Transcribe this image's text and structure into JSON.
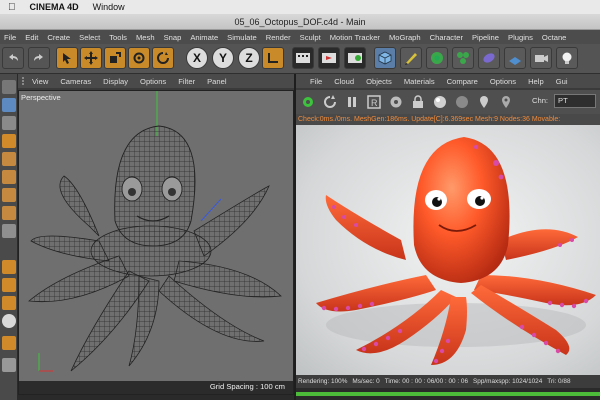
{
  "macos": {
    "app": "CINEMA 4D",
    "menu": [
      "Window"
    ]
  },
  "window": {
    "title": "05_06_Octopus_DOF.c4d - Main"
  },
  "main_menu": [
    "File",
    "Edit",
    "Create",
    "Select",
    "Tools",
    "Mesh",
    "Snap",
    "Animate",
    "Simulate",
    "Render",
    "Sculpt",
    "Motion Tracker",
    "MoGraph",
    "Character",
    "Pipeline",
    "Plugins",
    "Octane"
  ],
  "toolbar": {
    "axis_x": "X",
    "axis_y": "Y",
    "axis_z": "Z"
  },
  "viewport": {
    "menu": [
      "View",
      "Cameras",
      "Display",
      "Options",
      "Filter",
      "Panel"
    ],
    "label": "Perspective",
    "grid_spacing": "Grid Spacing : 100 cm"
  },
  "render_view": {
    "menu": [
      "File",
      "Cloud",
      "Objects",
      "Materials",
      "Compare",
      "Options",
      "Help",
      "Gui"
    ],
    "channel_label": "Chn:",
    "channel_value": "PT",
    "status": "Check:0ms./0ms. MeshGen:186ms. Update[C]:6.369sec Mesh:9 Nodes:36 Movable:",
    "bottom": {
      "rendering": "Rendering: 100%",
      "ms_sec": "Ms/sec: 0",
      "time": "Time: 00 : 00 : 06/00 : 00 : 06",
      "spp": "Spp/maxspp: 1024/1024",
      "tri": "Tri: 0/88"
    },
    "progress": 1.0
  },
  "colors": {
    "accent": "#c98a2a",
    "status_orange": "#f08a3a",
    "progress_green": "#4cbb3a",
    "octopus_orange": "#ff5a2a",
    "suckers_pink": "#d94aa6"
  }
}
